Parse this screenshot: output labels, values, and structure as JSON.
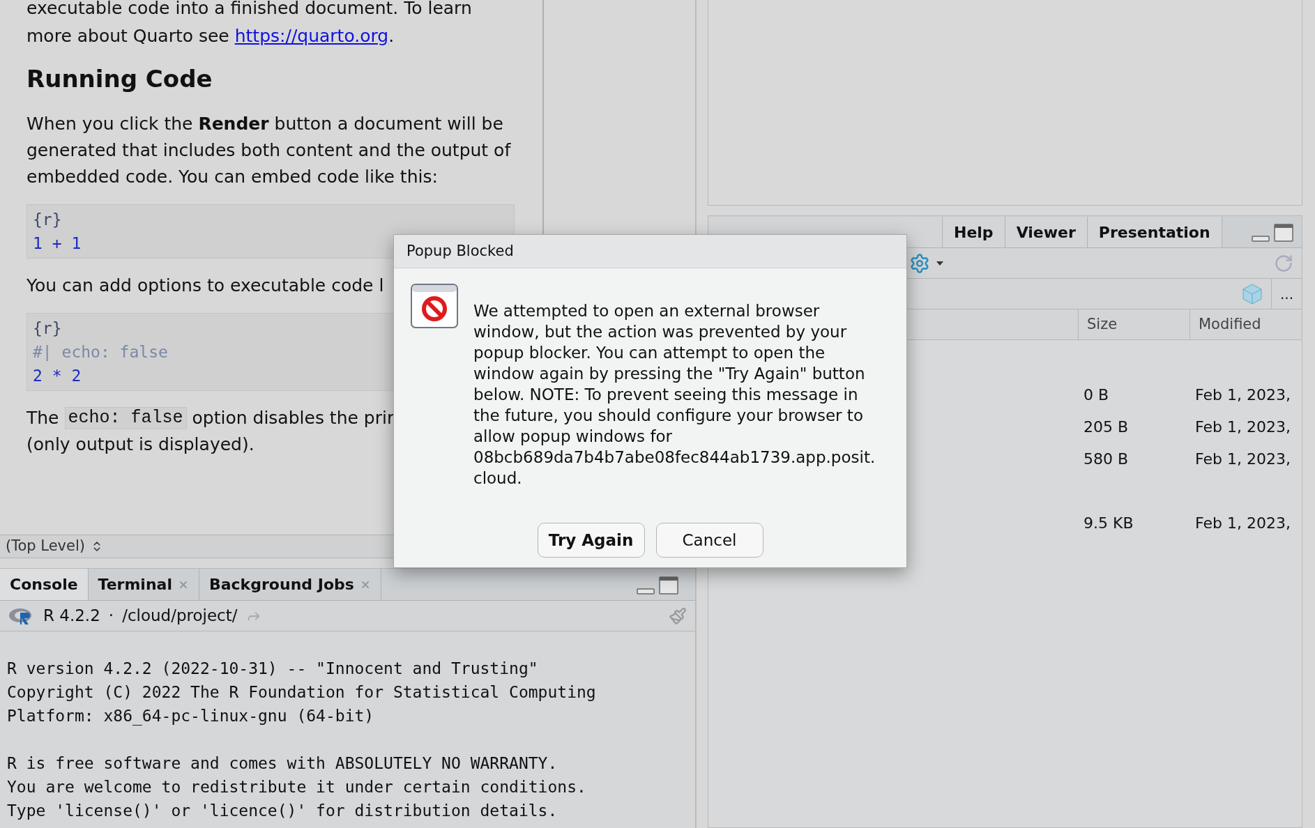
{
  "document": [
    {
      "kind": "link_paragraph",
      "text": "executable code into a finished document. To learn more about Quarto see ",
      "link": "https://quarto.org",
      "after": "."
    },
    {
      "kind": "heading",
      "text": "Running Code"
    },
    {
      "kind": "paragraph",
      "text": "When you click the **Render** button a document will be generated that includes both content and the output of embedded code. You can embed code like this:"
    },
    {
      "kind": "code",
      "lines": [
        {
          "kind": "header",
          "text": "{r}"
        },
        {
          "kind": "code",
          "text": "1 + 1"
        }
      ]
    },
    {
      "kind": "paragraph",
      "text": "You can add options to executable code l"
    },
    {
      "kind": "code",
      "lines": [
        {
          "kind": "header",
          "text": "{r}"
        },
        {
          "kind": "comment",
          "text": "#| echo: false"
        },
        {
          "kind": "code",
          "text": "2 * 2"
        }
      ]
    },
    {
      "kind": "inline_code_paragraph",
      "before": "The",
      "code": "echo: false",
      "after": "option disables the prir",
      "continuation": "(only output is displayed)."
    }
  ],
  "scope_bar": {
    "label": "(Top Level)"
  },
  "console": {
    "tabs": [
      {
        "label": "Console",
        "selected": true,
        "closable": false
      },
      {
        "label": "Terminal",
        "selected": false,
        "closable": true
      },
      {
        "label": "Background Jobs",
        "selected": false,
        "closable": true
      }
    ],
    "version": "R 4.2.2",
    "separator": "·",
    "path": "/cloud/project/",
    "output_blocks": [
      [
        "R version 4.2.2 (2022-10-31) -- \"Innocent and Trusting\"",
        "Copyright (C) 2022 The R Foundation for Statistical Computing",
        "Platform: x86_64-pc-linux-gnu (64-bit)"
      ],
      [
        "R is free software and comes with ABSOLUTELY NO WARRANTY.",
        "You are welcome to redistribute it under certain conditions.",
        "Type 'license()' or 'licence()' for distribution details."
      ]
    ]
  },
  "files_pane": {
    "tabs": [
      {
        "label": "Help"
      },
      {
        "label": "Viewer"
      },
      {
        "label": "Presentation"
      }
    ],
    "more": "...",
    "columns": [
      "Size",
      "Modified"
    ],
    "rows": [
      {
        "size": "0 B",
        "modified": "Feb 1, 2023,",
        "gap_before": false
      },
      {
        "size": "205 B",
        "modified": "Feb 1, 2023,",
        "gap_before": false
      },
      {
        "size": "580 B",
        "modified": "Feb 1, 2023,",
        "gap_before": false
      },
      {
        "size": "9.5 KB",
        "modified": "Feb 1, 2023,",
        "gap_before": true
      }
    ]
  },
  "dialog": {
    "title": "Popup Blocked",
    "message": "We attempted to open an external browser window, but the action was prevented by your popup blocker. You can attempt to open the window again by pressing the \"Try Again\" button below. NOTE: To prevent seeing this message in the future, you should configure your browser to allow popup windows for 08bcb689da7b4b7abe08fec844ab1739.app.posit. cloud.",
    "buttons": [
      {
        "label": "Try Again",
        "kind": "primary"
      },
      {
        "label": "Cancel",
        "kind": "secondary"
      }
    ]
  }
}
